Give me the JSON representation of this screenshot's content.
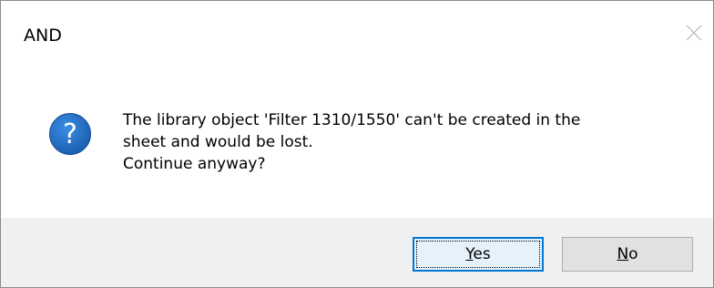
{
  "dialog": {
    "title": "AND",
    "message": "The library object 'Filter 1310/1550' can't be created in the\nsheet and would be lost.\nContinue anyway?",
    "icon": "question-icon",
    "buttons": {
      "yes": {
        "mnemonic": "Y",
        "rest": "es"
      },
      "no": {
        "mnemonic": "N",
        "rest": "o"
      }
    }
  },
  "colors": {
    "accent": "#0078d7",
    "icon_blue": "#1c5fb0",
    "footer_bg": "#f0f0f0"
  }
}
